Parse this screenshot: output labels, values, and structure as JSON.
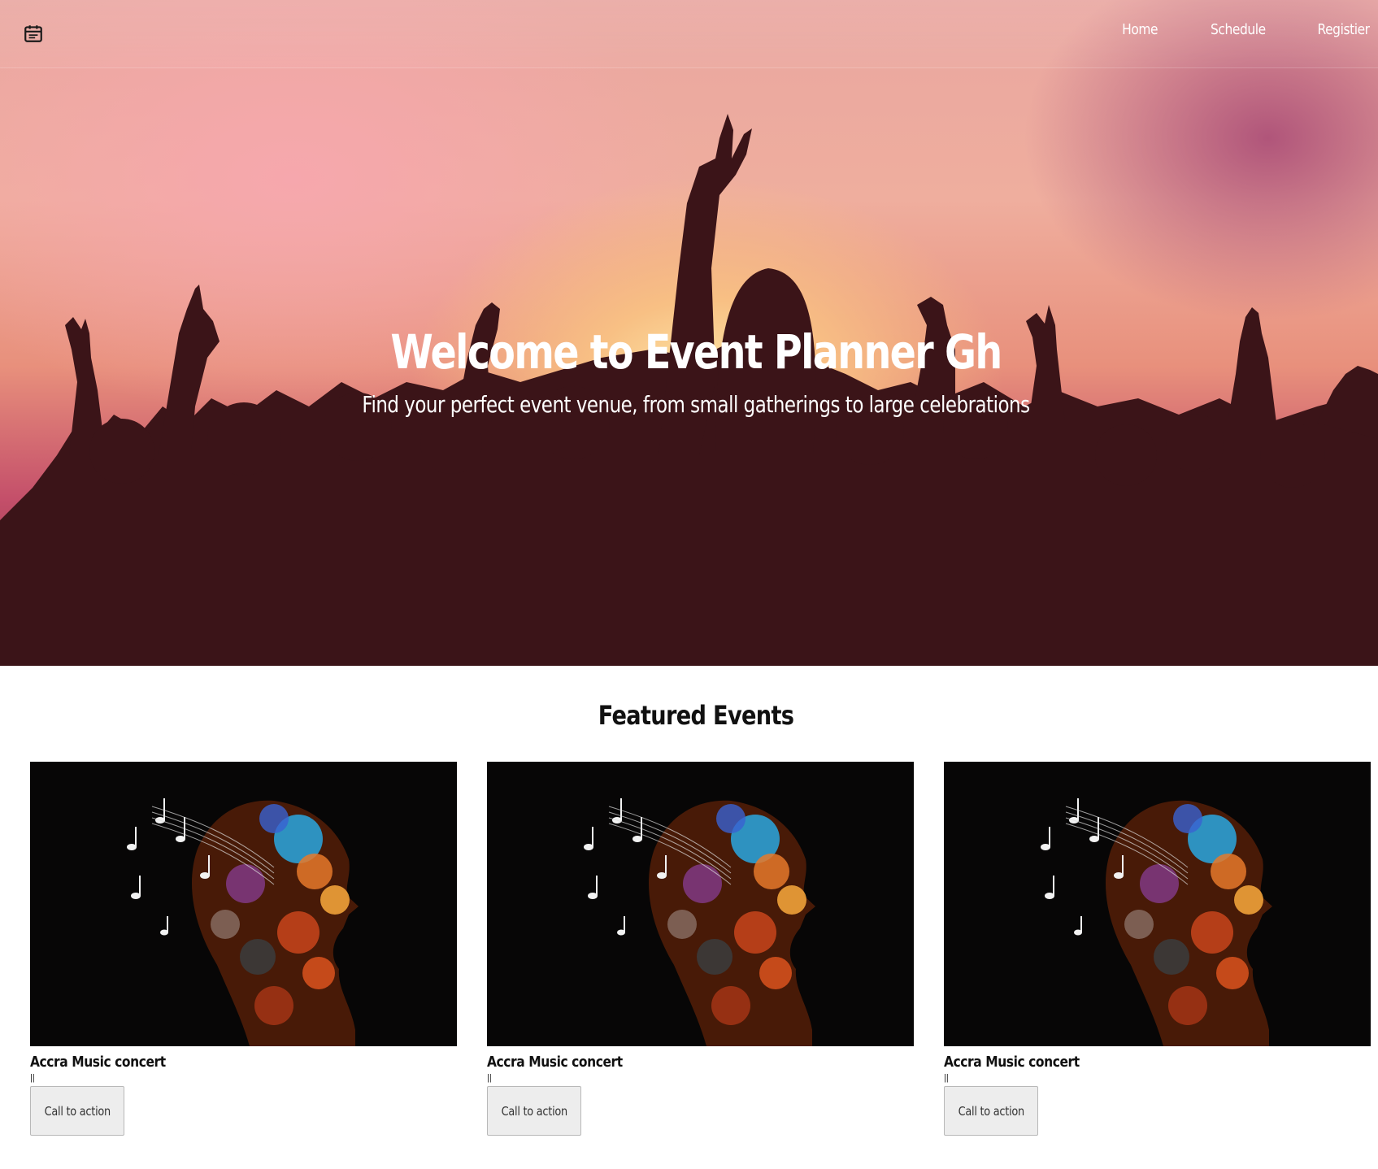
{
  "navbar": {
    "brand_icon": "calendar-icon",
    "links": [
      {
        "label": "Home"
      },
      {
        "label": "Schedule"
      },
      {
        "label": "Registier"
      }
    ]
  },
  "hero": {
    "title": "Welcome to Event Planner Gh",
    "subtitle": "Find your perfect event venue, from small gatherings to large celebrations",
    "colors": {
      "glow": "#fde7a6",
      "sky_pink": "#f6a7ad",
      "silhouette": "#3b1418"
    }
  },
  "featured": {
    "title": "Featured Events",
    "cards": [
      {
        "title": "Accra Music concert",
        "meta": "||",
        "button_label": "Call to action"
      },
      {
        "title": "Accra Music concert",
        "meta": "||",
        "button_label": "Call to action"
      },
      {
        "title": "Accra Music concert",
        "meta": "||",
        "button_label": "Call to action"
      }
    ]
  }
}
